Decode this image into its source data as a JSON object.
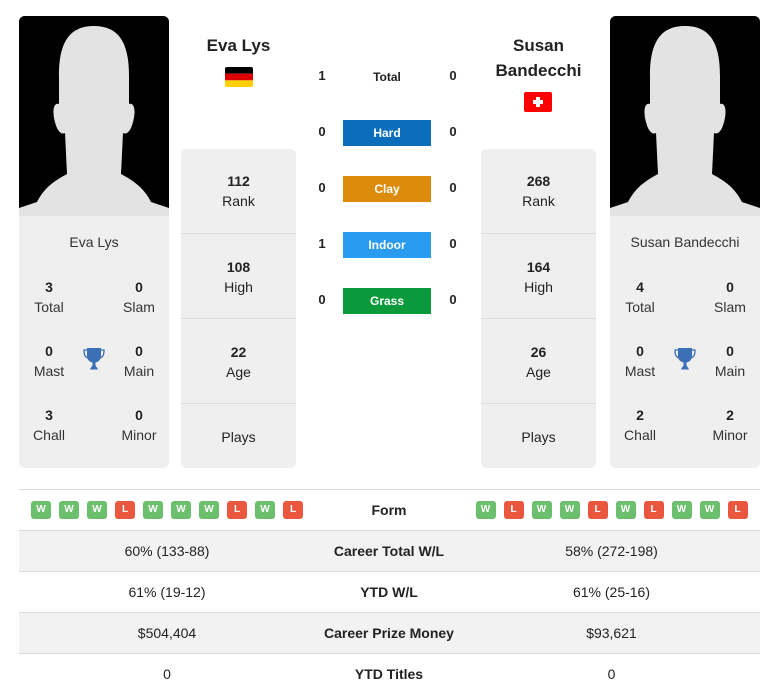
{
  "player1": {
    "name": "Eva Lys",
    "country": "Germany",
    "flag_colors": [
      "#000000",
      "#dd0000",
      "#ffce00"
    ],
    "titles": {
      "total": {
        "value": "3",
        "label": "Total"
      },
      "slam": {
        "value": "0",
        "label": "Slam"
      },
      "mast": {
        "value": "0",
        "label": "Mast"
      },
      "main": {
        "value": "0",
        "label": "Main"
      },
      "chall": {
        "value": "3",
        "label": "Chall"
      },
      "minor": {
        "value": "0",
        "label": "Minor"
      }
    },
    "stats": {
      "rank": {
        "value": "112",
        "label": "Rank"
      },
      "high": {
        "value": "108",
        "label": "High"
      },
      "age": {
        "value": "22",
        "label": "Age"
      },
      "plays": {
        "value": "",
        "label": "Plays"
      }
    },
    "form": [
      "W",
      "W",
      "W",
      "L",
      "W",
      "W",
      "W",
      "L",
      "W",
      "L"
    ]
  },
  "player2": {
    "name": "Susan Bandecchi",
    "name_line1": "Susan",
    "name_line2": "Bandecchi",
    "country": "Switzerland",
    "flag_colors": [
      "#ff0000",
      "#ffffff"
    ],
    "titles": {
      "total": {
        "value": "4",
        "label": "Total"
      },
      "slam": {
        "value": "0",
        "label": "Slam"
      },
      "mast": {
        "value": "0",
        "label": "Mast"
      },
      "main": {
        "value": "0",
        "label": "Main"
      },
      "chall": {
        "value": "2",
        "label": "Chall"
      },
      "minor": {
        "value": "2",
        "label": "Minor"
      }
    },
    "stats": {
      "rank": {
        "value": "268",
        "label": "Rank"
      },
      "high": {
        "value": "164",
        "label": "High"
      },
      "age": {
        "value": "26",
        "label": "Age"
      },
      "plays": {
        "value": "",
        "label": "Plays"
      }
    },
    "form": [
      "W",
      "L",
      "W",
      "W",
      "L",
      "W",
      "L",
      "W",
      "W",
      "L"
    ]
  },
  "h2h": [
    {
      "label": "Total",
      "p1": "1",
      "p2": "0",
      "color": ""
    },
    {
      "label": "Hard",
      "p1": "0",
      "p2": "0",
      "color": "#0a6ebd"
    },
    {
      "label": "Clay",
      "p1": "0",
      "p2": "0",
      "color": "#dc8c0a"
    },
    {
      "label": "Indoor",
      "p1": "1",
      "p2": "0",
      "color": "#2a9cf0"
    },
    {
      "label": "Grass",
      "p1": "0",
      "p2": "0",
      "color": "#0a9a3c"
    }
  ],
  "comparison": {
    "form_label": "Form",
    "rows": [
      {
        "label": "Career Total W/L",
        "p1": "60% (133-88)",
        "p2": "58% (272-198)"
      },
      {
        "label": "YTD W/L",
        "p1": "61% (19-12)",
        "p2": "61% (25-16)"
      },
      {
        "label": "Career Prize Money",
        "p1": "$504,404",
        "p2": "$93,621"
      },
      {
        "label": "YTD Titles",
        "p1": "0",
        "p2": "0"
      }
    ]
  },
  "icons": {
    "trophy": "trophy-icon",
    "avatar": "avatar-silhouette"
  },
  "colors": {
    "win": "#6cbf6c",
    "loss": "#e8573e",
    "trophy": "#3b6fb6",
    "panel": "#efefef"
  }
}
